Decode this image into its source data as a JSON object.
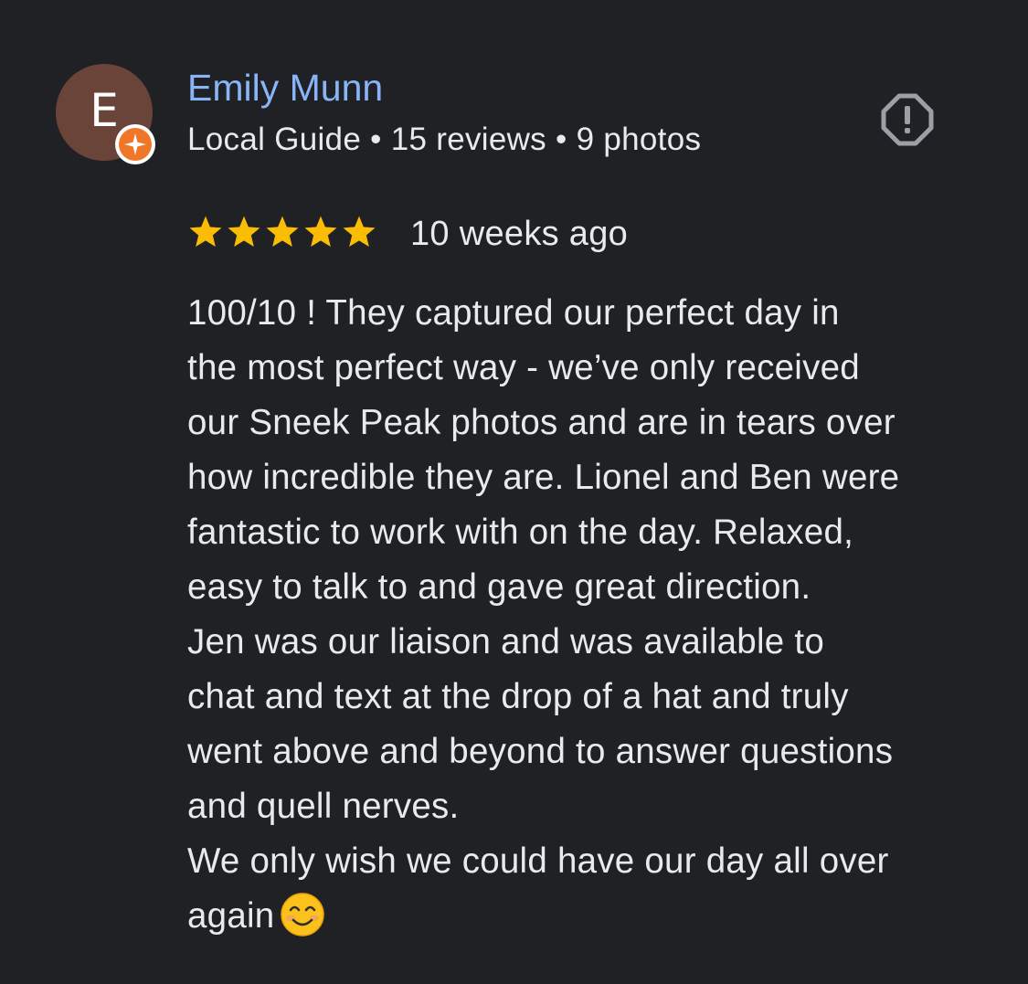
{
  "author": {
    "avatar_letter": "E",
    "name": "Emily Munn",
    "meta": "Local Guide • 15 reviews • 9 photos"
  },
  "rating": {
    "stars": 5,
    "max_stars": 5,
    "star_color": "#fbbc04",
    "time_ago": "10 weeks ago"
  },
  "colors": {
    "background": "#202124",
    "name": "#8ab4f8",
    "avatar": "#6b4439",
    "badge": "#f0772a"
  },
  "icons": {
    "report": "report-flag-icon",
    "badge": "local-guide-badge-icon",
    "emoji": "smiling-face-emoji"
  },
  "review": {
    "lines": [
      "100/10 ! They captured our perfect day in",
      "the most perfect way - we’ve only received",
      "our Sneek Peak photos and are in tears over",
      "how incredible they are. Lionel and Ben were",
      "fantastic to work with on the day. Relaxed,",
      "easy to talk to and gave great direction.",
      "Jen was our liaison and was available to",
      "chat and text at the drop of a hat and truly",
      "went above and beyond to answer questions",
      "and quell nerves.",
      "We only wish we could have our day all over",
      "again"
    ]
  }
}
